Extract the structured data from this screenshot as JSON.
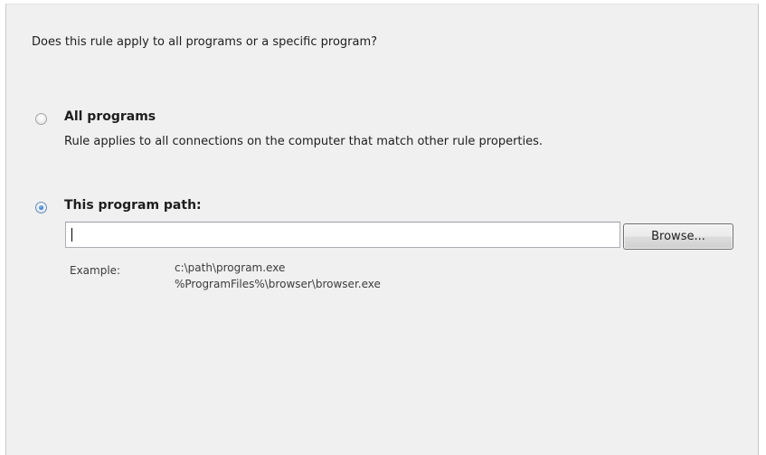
{
  "question": "Does this rule apply to all programs or a specific program?",
  "options": [
    {
      "label": "All programs",
      "description": "Rule applies to all connections on the computer that match other rule properties.",
      "selected": false
    },
    {
      "label": "This program path:",
      "selected": true
    }
  ],
  "path_field": {
    "value": ""
  },
  "browse_label": "Browse...",
  "example": {
    "label": "Example:",
    "lines": [
      "c:\\path\\program.exe",
      "%ProgramFiles%\\browser\\browser.exe"
    ]
  }
}
